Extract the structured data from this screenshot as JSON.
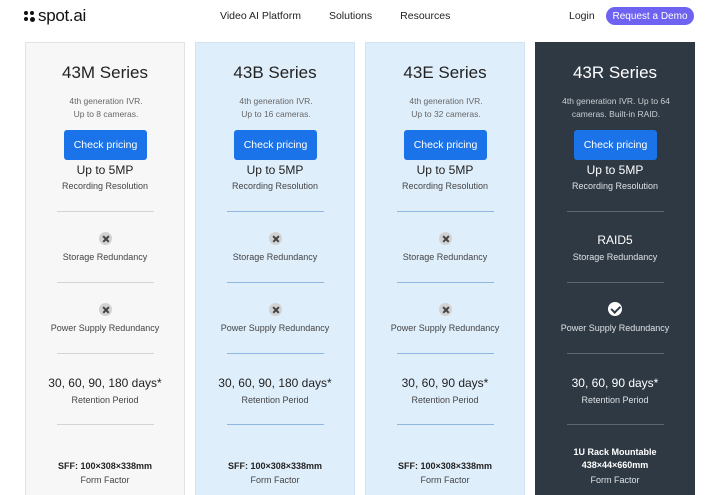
{
  "nav": {
    "logo": "spot.ai",
    "links": [
      "Video AI Platform",
      "Solutions",
      "Resources"
    ],
    "login": "Login",
    "demo": "Request a Demo"
  },
  "labels": {
    "resolution": "Recording Resolution",
    "storage": "Storage Redundancy",
    "power": "Power Supply Redundancy",
    "retention": "Retention Period",
    "form": "Form Factor"
  },
  "icons": {
    "no": "x-circle-icon",
    "yes": "check-circle-icon"
  },
  "colors": {
    "accent": "#1a73e8",
    "demo": "#6d63f0",
    "dark_card": "#2f3944",
    "light_card": "#dfeefb"
  },
  "plans": [
    {
      "name": "43M Series",
      "desc_lines": [
        "4th generation IVR.",
        "Up to 8 cameras."
      ],
      "cta": "Check pricing",
      "resolution": "Up to 5MP",
      "storage_value": "",
      "storage_supported": false,
      "power_supported": false,
      "retention": "30, 60, 90, 180 days*",
      "form_lines": [
        "SFF: 100×308×338mm"
      ]
    },
    {
      "name": "43B Series",
      "desc_lines": [
        "4th generation IVR.",
        "Up to 16 cameras."
      ],
      "cta": "Check pricing",
      "resolution": "Up to 5MP",
      "storage_value": "",
      "storage_supported": false,
      "power_supported": false,
      "retention": "30, 60, 90, 180 days*",
      "form_lines": [
        "SFF: 100×308×338mm"
      ]
    },
    {
      "name": "43E Series",
      "desc_lines": [
        "4th generation IVR.",
        "Up to 32 cameras."
      ],
      "cta": "Check pricing",
      "resolution": "Up to 5MP",
      "storage_value": "",
      "storage_supported": false,
      "power_supported": false,
      "retention": "30, 60, 90 days*",
      "form_lines": [
        "SFF: 100×308×338mm"
      ]
    },
    {
      "name": "43R Series",
      "desc_lines": [
        "4th generation IVR. Up to 64",
        "cameras. Built-in RAID."
      ],
      "cta": "Check pricing",
      "resolution": "Up to 5MP",
      "storage_value": "RAID5",
      "storage_supported": true,
      "power_supported": true,
      "retention": "30, 60, 90 days*",
      "form_lines": [
        "1U Rack Mountable",
        "438×44×660mm"
      ]
    }
  ]
}
